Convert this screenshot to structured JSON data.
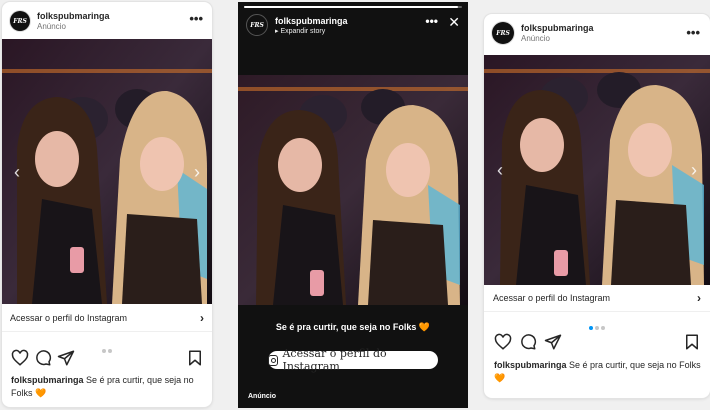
{
  "brand": {
    "username": "folkspubmaringa",
    "sponsored_label": "Anúncio",
    "avatar_text": "FRS"
  },
  "cta": {
    "label": "Acessar o perfil do Instagram"
  },
  "caption": {
    "text": "Se é pra curtir, que seja no Folks",
    "emoji": "🧡"
  },
  "story": {
    "expand_label": "▸ Expandir story",
    "text": "Se é pra curtir, que seja no Folks",
    "emoji": "🧡",
    "button_label": "Acessar o perfil do Instagram",
    "ad_label": "Anúncio"
  },
  "carousel": {
    "prev_glyph": "‹",
    "next_glyph": "›"
  },
  "icons": {
    "more": "•••",
    "close": "✕",
    "chevron": "›"
  },
  "colors": {
    "active_dot": "#0095f6",
    "heart": "#e8663a"
  }
}
